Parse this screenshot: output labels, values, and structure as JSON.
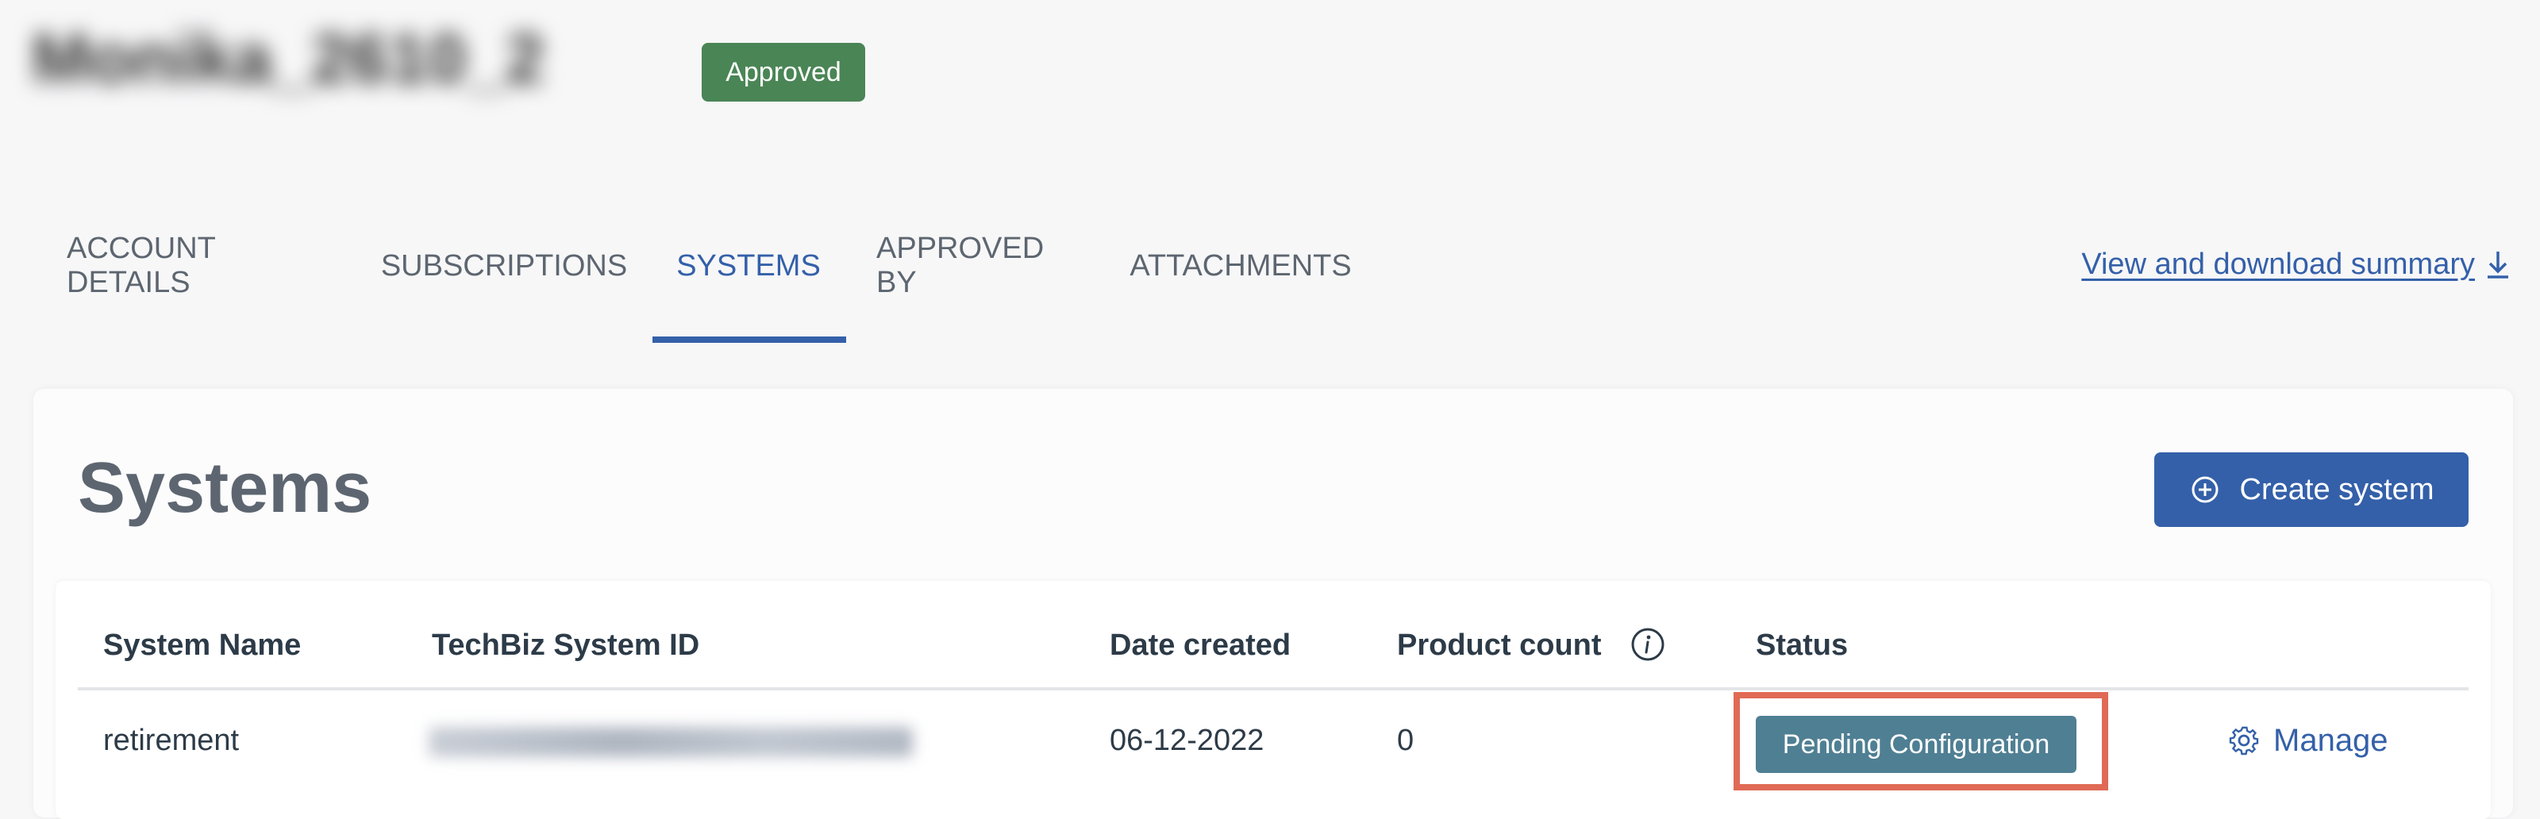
{
  "header": {
    "account_name": "Monika_2610_2",
    "badge": "Approved"
  },
  "tabs": [
    {
      "label": "ACCOUNT DETAILS"
    },
    {
      "label": "SUBSCRIPTIONS"
    },
    {
      "label": "SYSTEMS"
    },
    {
      "label": "APPROVED BY"
    },
    {
      "label": "ATTACHMENTS"
    }
  ],
  "active_tab": "SYSTEMS",
  "summary_link": "View and download summary",
  "panel": {
    "title": "Systems",
    "create_button": "Create system"
  },
  "table": {
    "columns": [
      "System Name",
      "TechBiz System ID",
      "Date created",
      "Product count",
      "Status"
    ],
    "rows": [
      {
        "system_name": "retirement",
        "date_created": "06-12-2022",
        "product_count": "0",
        "status": "Pending Configuration",
        "action": "Manage"
      }
    ]
  },
  "colors": {
    "primary": "#3460a9",
    "approved_badge": "#4a8555",
    "status_badge": "#4f7f93",
    "highlight": "#e06a55"
  }
}
